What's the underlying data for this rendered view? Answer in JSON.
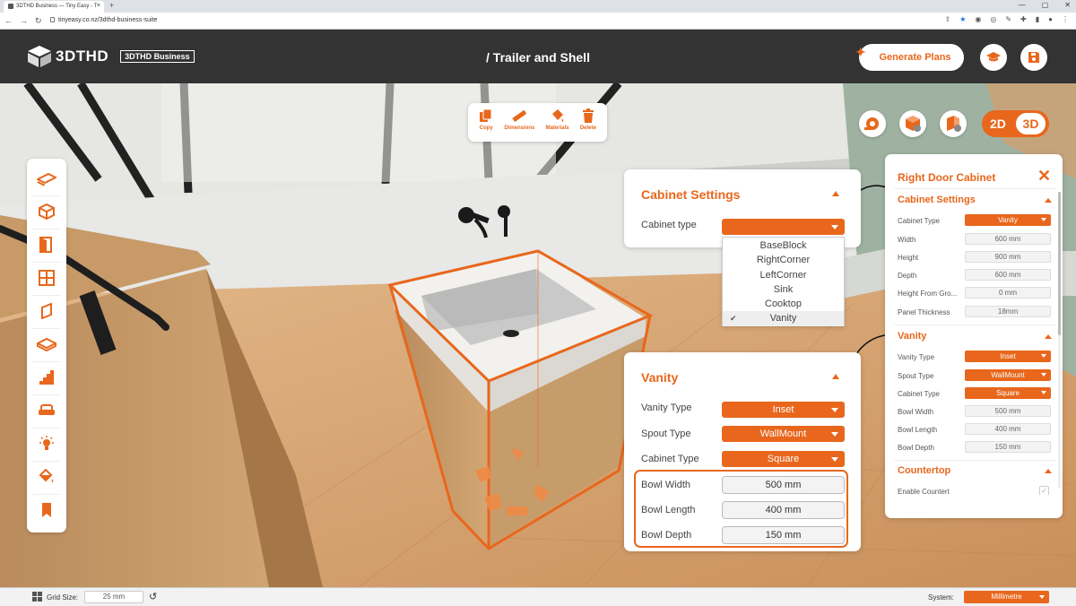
{
  "browser": {
    "tab_title": "3DTHD Business — Tiny Easy - T",
    "url": "tinyeasy.co.nz/3dthd-business-suite"
  },
  "header": {
    "logo_text": "3DTHD",
    "badge": "3DTHD Business",
    "title": "/ Trailer and Shell",
    "generate_plans": "Generate Plans",
    "accent": "#e8671c",
    "icons": [
      "graduation-cap-icon",
      "save-icon"
    ]
  },
  "edit_toolbar": {
    "copy": "Copy",
    "dimensions": "Dimensions",
    "materials": "Materials",
    "delete": "Delete"
  },
  "left_tools": [
    "floor-icon",
    "box-icon",
    "door-icon",
    "window-icon",
    "wall-panel-icon",
    "countertop-icon",
    "stairs-icon",
    "sofa-icon",
    "light-icon",
    "paint-bucket-icon",
    "bookmark-icon"
  ],
  "view_toggle": {
    "two_d": "2D",
    "three_d": "3D",
    "active": "3D"
  },
  "cabinet_panel": {
    "title": "Cabinet Settings",
    "type_label": "Cabinet type",
    "options": [
      "BaseBlock",
      "RightCorner",
      "LeftCorner",
      "Sink",
      "Cooktop",
      "Vanity"
    ],
    "selected": "Vanity"
  },
  "vanity_panel": {
    "title": "Vanity",
    "vanity_type_label": "Vanity Type",
    "vanity_type": "Inset",
    "spout_type_label": "Spout Type",
    "spout_type": "WallMount",
    "cabinet_type_label": "Cabinet Type",
    "cabinet_type": "Square",
    "bowl_width_label": "Bowl Width",
    "bowl_width": "500 mm",
    "bowl_length_label": "Bowl Length",
    "bowl_length": "400 mm",
    "bowl_depth_label": "Bowl Depth",
    "bowl_depth": "150 mm"
  },
  "right_panel": {
    "title": "Right Door Cabinet",
    "cabinet_settings": "Cabinet Settings",
    "cabinet_type_label": "Cabinet Type",
    "cabinet_type": "Vanity",
    "width_label": "Width",
    "width": "600 mm",
    "height_label": "Height",
    "height": "900 mm",
    "depth_label": "Depth",
    "depth": "600 mm",
    "height_from_ground_label": "Height From Gro...",
    "height_from_ground": "0 mm",
    "panel_thickness_label": "Panel Thickness",
    "panel_thickness": "18mm",
    "vanity": "Vanity",
    "vanity_type_label": "Vanity Type",
    "vanity_type": "Inset",
    "spout_type_label": "Spout Type",
    "spout_type": "WallMount",
    "cab_type_label": "Cabinet Type",
    "cab_type": "Square",
    "bowl_width_label": "Bowl Width",
    "bowl_width": "500 mm",
    "bowl_length_label": "Bowl Length",
    "bowl_length": "400 mm",
    "bowl_depth_label": "Bowl Depth",
    "bowl_depth": "150 mm",
    "countertop": "Countertop",
    "enable_countertop_label": "Enable Countert"
  },
  "bottom_bar": {
    "grid_size_label": "Grid Size:",
    "grid_size": "25 mm",
    "system_label": "System:",
    "system": "Millimetre"
  }
}
